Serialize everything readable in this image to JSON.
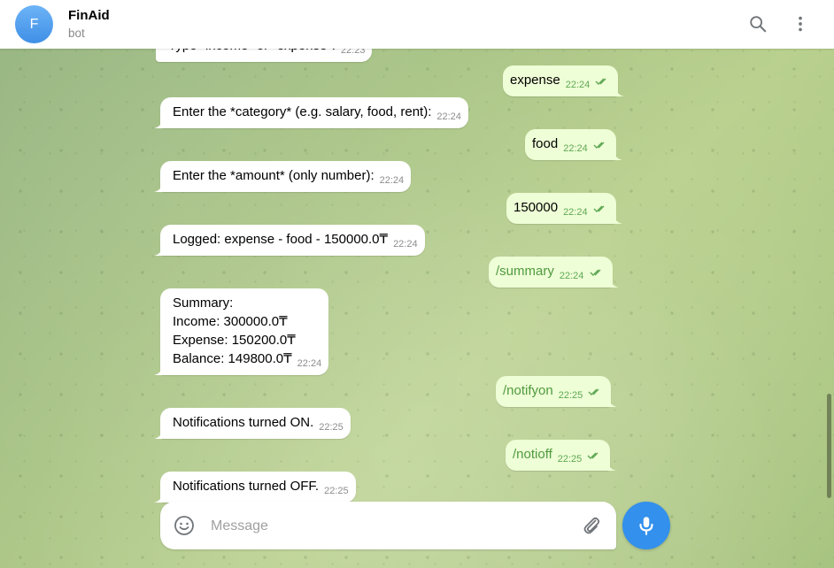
{
  "header": {
    "avatar_letter": "F",
    "title": "FinAid",
    "subtitle": "bot"
  },
  "composer": {
    "placeholder": "Message"
  },
  "messages": [
    {
      "dir": "in",
      "text": "Type \"income\" or \"expense\":",
      "time": "22:23"
    },
    {
      "dir": "out",
      "text": "expense",
      "time": "22:24"
    },
    {
      "dir": "in",
      "text": "Enter the *category* (e.g. salary, food, rent):",
      "time": "22:24"
    },
    {
      "dir": "out",
      "text": "food",
      "time": "22:24"
    },
    {
      "dir": "in",
      "text": "Enter the *amount* (only number):",
      "time": "22:24"
    },
    {
      "dir": "out",
      "text": "150000",
      "time": "22:24"
    },
    {
      "dir": "in",
      "text": "Logged: expense - food - 150000.0₸",
      "time": "22:24"
    },
    {
      "dir": "out",
      "text": "/summary",
      "time": "22:24"
    },
    {
      "dir": "in",
      "lines": [
        "Summary:",
        "Income: 300000.0₸",
        "Expense: 150200.0₸",
        "Balance: 149800.0₸"
      ],
      "time": "22:24"
    },
    {
      "dir": "out",
      "text": "/notifyon",
      "time": "22:25"
    },
    {
      "dir": "in",
      "text": "Notifications turned ON.",
      "time": "22:25"
    },
    {
      "dir": "out",
      "text": "/notioff",
      "time": "22:25"
    },
    {
      "dir": "in",
      "text": "Notifications turned OFF.",
      "time": "22:25"
    }
  ],
  "colors": {
    "accent": "#3390ec",
    "outgoing_bubble": "#eefed6",
    "command_text": "#4f9a3f"
  }
}
